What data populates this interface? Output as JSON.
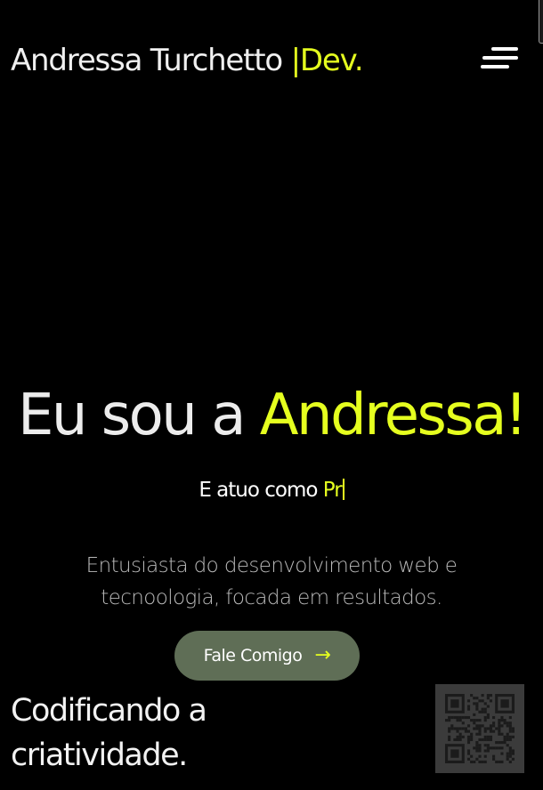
{
  "header": {
    "brand_name": "Andressa Turchetto",
    "brand_suffix": "|Dev.",
    "menu_icon": "hamburger-menu-icon"
  },
  "hero": {
    "title_prefix": "Eu sou a",
    "title_name": "Andressa!",
    "role_prefix": "E atuo como",
    "role_typed": "Pr",
    "description": "Entusiasta do desenvolvimento web e tecnoologia, focada em resultados.",
    "cta_label": "Fale Comigo",
    "cta_icon": "arrow-right-icon"
  },
  "footer": {
    "tagline": "Codificando a criatividade.",
    "qr_icon": "qr-code-icon"
  },
  "colors": {
    "background": "#000000",
    "accent": "#e5ff1f",
    "button": "#5f6e56",
    "text": "#f2f2f2",
    "muted_text": "#b9b9b9",
    "qr_background": "#3b3b3b"
  }
}
